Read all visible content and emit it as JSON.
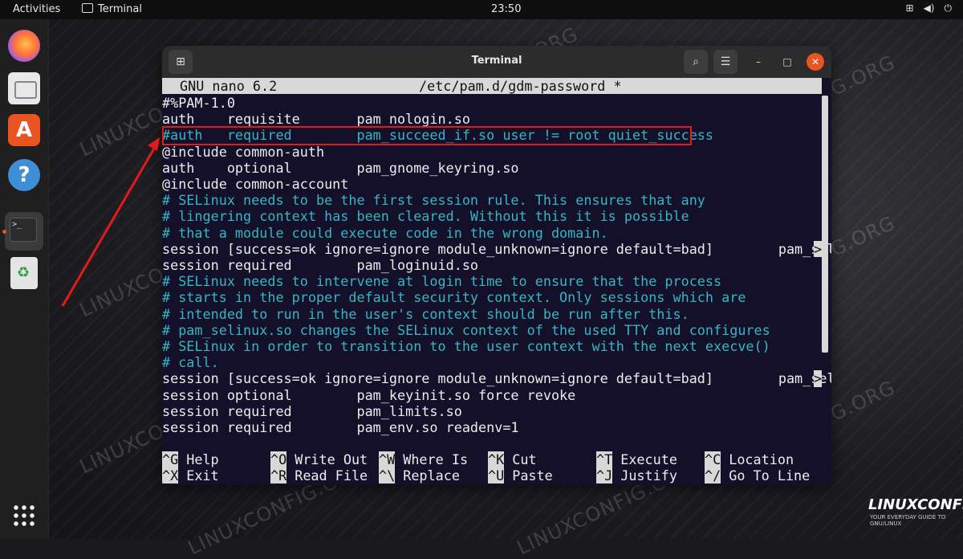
{
  "topbar": {
    "activities": "Activities",
    "app_name": "Terminal",
    "clock": "23:50",
    "tray_icons": [
      "network-icon",
      "volume-icon",
      "power-icon"
    ]
  },
  "dock": {
    "items": [
      "firefox-icon",
      "files-icon",
      "software-icon",
      "help-icon",
      "terminal-icon",
      "trash-icon",
      "show-apps-icon"
    ],
    "terminal_prompt": ">_"
  },
  "window": {
    "title": "Terminal"
  },
  "nano": {
    "header_left": "GNU nano 6.2",
    "header_file": "/etc/pam.d/gdm-password *",
    "lines": [
      {
        "text": "#%PAM-1.0",
        "comment": false
      },
      {
        "text": "auth    requisite       pam_nologin.so",
        "comment": false
      },
      {
        "text": "#auth   required        pam_succeed_if.so user != root quiet_success",
        "comment": true
      },
      {
        "text": "@include common-auth",
        "comment": false
      },
      {
        "text": "auth    optional        pam_gnome_keyring.so",
        "comment": false
      },
      {
        "text": "@include common-account",
        "comment": false
      },
      {
        "text": "# SELinux needs to be the first session rule. This ensures that any",
        "comment": true
      },
      {
        "text": "# lingering context has been cleared. Without this it is possible",
        "comment": true
      },
      {
        "text": "# that a module could execute code in the wrong domain.",
        "comment": true
      },
      {
        "text": "session [success=ok ignore=ignore module_unknown=ignore default=bad]        pam_seli",
        "comment": false,
        "more": ">"
      },
      {
        "text": "session required        pam_loginuid.so",
        "comment": false
      },
      {
        "text": "# SELinux needs to intervene at login time to ensure that the process",
        "comment": true
      },
      {
        "text": "# starts in the proper default security context. Only sessions which are",
        "comment": true
      },
      {
        "text": "# intended to run in the user's context should be run after this.",
        "comment": true
      },
      {
        "text": "# pam_selinux.so changes the SELinux context of the used TTY and configures",
        "comment": true
      },
      {
        "text": "# SELinux in order to transition to the user context with the next execve()",
        "comment": true
      },
      {
        "text": "# call.",
        "comment": true
      },
      {
        "text": "session [success=ok ignore=ignore module_unknown=ignore default=bad]        pam_seli",
        "comment": false,
        "more": ">"
      },
      {
        "text": "session optional        pam_keyinit.so force revoke",
        "comment": false
      },
      {
        "text": "session required        pam_limits.so",
        "comment": false
      },
      {
        "text": "session required        pam_env.so readenv=1",
        "comment": false
      }
    ],
    "shortcuts_row1": [
      {
        "key": "^G",
        "label": "Help"
      },
      {
        "key": "^O",
        "label": "Write Out"
      },
      {
        "key": "^W",
        "label": "Where Is"
      },
      {
        "key": "^K",
        "label": "Cut"
      },
      {
        "key": "^T",
        "label": "Execute"
      },
      {
        "key": "^C",
        "label": "Location"
      }
    ],
    "shortcuts_row2": [
      {
        "key": "^X",
        "label": "Exit"
      },
      {
        "key": "^R",
        "label": "Read File"
      },
      {
        "key": "^\\",
        "label": "Replace"
      },
      {
        "key": "^U",
        "label": "Paste"
      },
      {
        "key": "^J",
        "label": "Justify"
      },
      {
        "key": "^/",
        "label": "Go To Line"
      }
    ]
  },
  "watermark": "LINUXCONFIG.ORG",
  "logo": {
    "name": "LINUXCONFIG",
    "tagline": "YOUR EVERYDAY GUIDE TO GNU/LINUX"
  },
  "colors": {
    "annotation": "#e11b1b",
    "comment": "#35b6c2",
    "accent": "#e95420"
  }
}
